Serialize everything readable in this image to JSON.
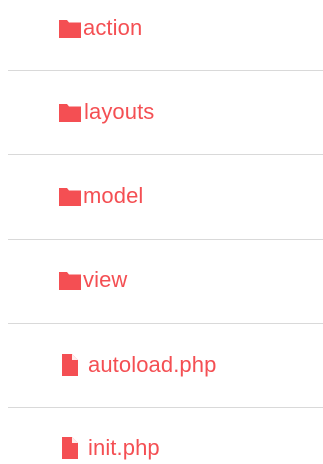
{
  "accent_color": "#f44f53",
  "items": [
    {
      "type": "folder",
      "icon": "folder-icon",
      "label": "action"
    },
    {
      "type": "folder",
      "icon": "folder-icon",
      "label": "layouts"
    },
    {
      "type": "folder",
      "icon": "folder-icon",
      "label": "model"
    },
    {
      "type": "folder",
      "icon": "folder-icon",
      "label": "view"
    },
    {
      "type": "file",
      "icon": "file-icon",
      "label": "autoload.php"
    },
    {
      "type": "file",
      "icon": "file-icon",
      "label": "init.php"
    }
  ]
}
